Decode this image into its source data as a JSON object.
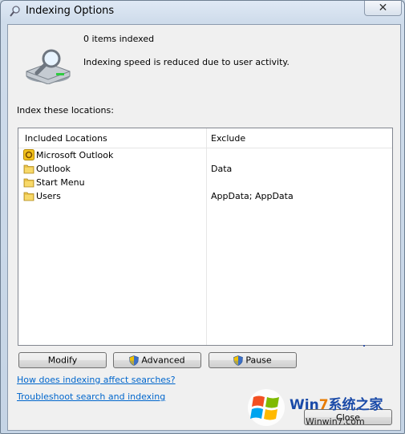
{
  "window": {
    "title": "Indexing Options",
    "close_glyph": "✕"
  },
  "status": {
    "items_indexed": "0 items indexed",
    "speed_message": "Indexing speed is reduced due to user activity."
  },
  "index_label": "Index these locations:",
  "list": {
    "columns": [
      "Included Locations",
      "Exclude"
    ],
    "rows": [
      {
        "name": "Microsoft Outlook",
        "exclude": "",
        "icon": "outlook-icon"
      },
      {
        "name": "Outlook",
        "exclude": "Data",
        "icon": "folder-icon"
      },
      {
        "name": "Start Menu",
        "exclude": "",
        "icon": "folder-icon"
      },
      {
        "name": "Users",
        "exclude": "AppData; AppData",
        "icon": "folder-icon"
      }
    ]
  },
  "buttons": {
    "modify": "Modify",
    "advanced": "Advanced",
    "pause": "Pause",
    "close": "Close"
  },
  "links": {
    "affect_searches": "How does indexing affect searches?",
    "troubleshoot": "Troubleshoot search and indexing"
  },
  "watermark": {
    "brand": "Win",
    "seven": "7",
    "suffix": "系统之家",
    "url": "Winwin7.com"
  },
  "colors": {
    "link": "#0066cc",
    "folder": "#e9c24b",
    "shield_blue": "#3b6fc7",
    "shield_yellow": "#f2c200"
  }
}
